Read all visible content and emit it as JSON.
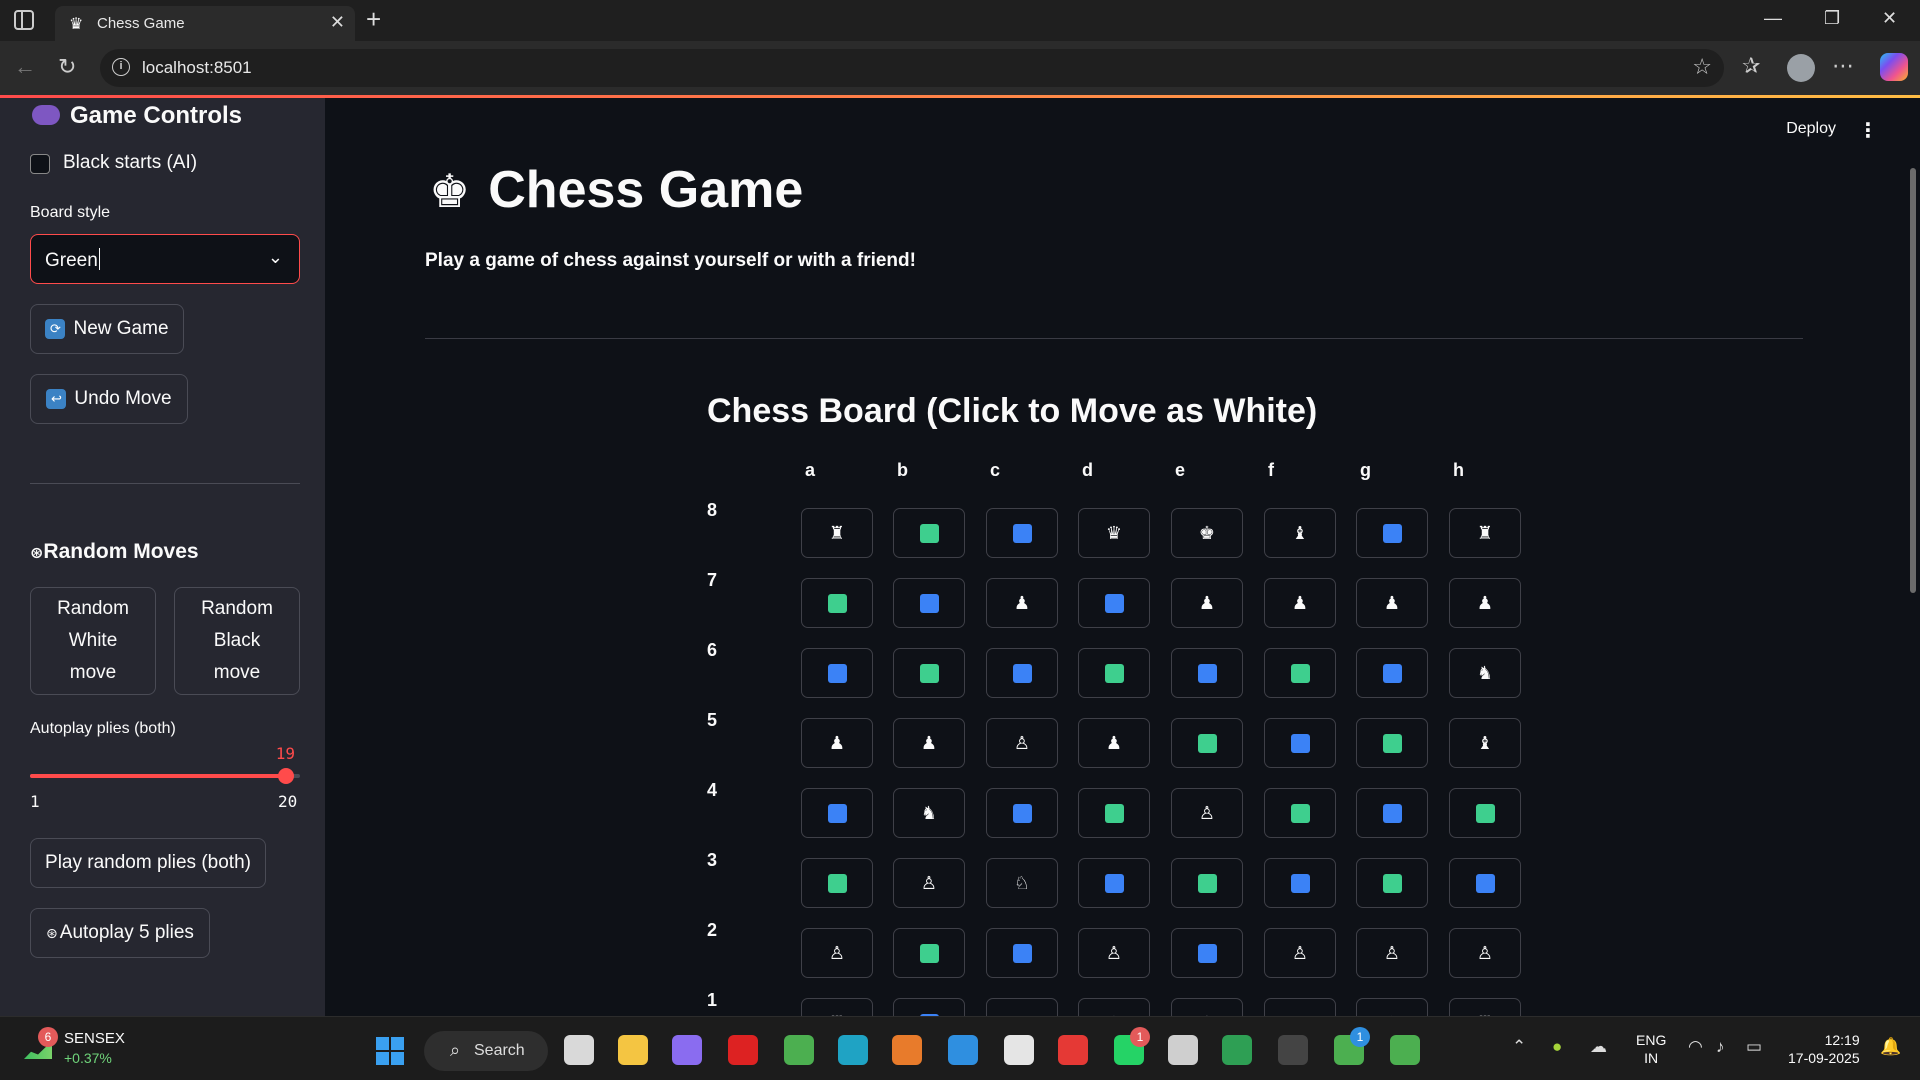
{
  "browser": {
    "tab_title": "Chess Game",
    "tab_favicon": "♛",
    "url": "localhost:8501"
  },
  "sidebar": {
    "title": "Game Controls",
    "checkbox_label": "Black starts (AI)",
    "board_style_label": "Board style",
    "board_style_value": "Green",
    "new_game": "New Game",
    "undo_move": "Undo Move",
    "random_moves_title": "Random Moves",
    "random_white": "Random White move",
    "random_black": "Random Black move",
    "autoplay_label": "Autoplay plies (both)",
    "slider": {
      "value": 19,
      "min": 1,
      "max": 20
    },
    "play_random": "Play random plies (both)",
    "autoplay_5": "Autoplay 5 plies"
  },
  "main": {
    "deploy": "Deploy",
    "title": "Chess Game",
    "title_icon": "♚",
    "subtitle": "Play a game of chess against yourself or with a friend!",
    "board_title": "Chess Board (Click to Move as White)",
    "files": [
      "a",
      "b",
      "c",
      "d",
      "e",
      "f",
      "g",
      "h"
    ],
    "ranks": [
      "8",
      "7",
      "6",
      "5",
      "4",
      "3",
      "2",
      "1"
    ],
    "colors": {
      "green": "#3ecf8e",
      "blue": "#3b82f6",
      "accent": "#ff4b4b"
    },
    "board": [
      [
        "♜",
        "G",
        "B",
        "♛",
        "♚",
        "♝",
        "B",
        "♜"
      ],
      [
        "G",
        "B",
        "♟",
        "B",
        "♟",
        "♟",
        "♟",
        "♟"
      ],
      [
        "B",
        "G",
        "B",
        "G",
        "B",
        "G",
        "B",
        "♞"
      ],
      [
        "♟",
        "♟",
        "♙",
        "♟",
        "G",
        "B",
        "G",
        "♝"
      ],
      [
        "B",
        "♞",
        "B",
        "G",
        "♙",
        "G",
        "B",
        "G"
      ],
      [
        "G",
        "♙",
        "♘",
        "B",
        "G",
        "B",
        "G",
        "B"
      ],
      [
        "♙",
        "G",
        "B",
        "♙",
        "B",
        "♙",
        "♙",
        "♙"
      ],
      [
        "♖",
        "B",
        "♗",
        "♕",
        "♔",
        "♗",
        "♘",
        "♖"
      ]
    ]
  },
  "taskbar": {
    "widget_name": "SENSEX",
    "widget_value": "+0.37%",
    "widget_badge": "6",
    "search": "Search",
    "whatsapp_badge": "1",
    "chrome_badge": "1",
    "lang_top": "ENG",
    "lang_bottom": "IN",
    "time": "12:19",
    "date": "17-09-2025"
  }
}
